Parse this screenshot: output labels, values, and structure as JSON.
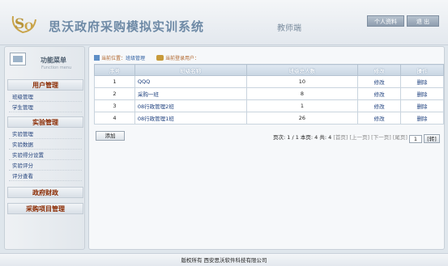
{
  "header": {
    "logo_text": "SO",
    "title": "思沃政府采购模拟实训系统",
    "role": "教师端",
    "buttons": [
      "个人资料",
      "退 出"
    ]
  },
  "sidebar": {
    "title": "功能菜单",
    "subtitle": "Function menu",
    "sections": [
      {
        "label": "用户管理",
        "items": [
          "班级管理",
          "学生管理"
        ]
      },
      {
        "label": "实验管理",
        "items": [
          "实验管理",
          "实验数据",
          "实验得分设置",
          "实验评分",
          "评分查看"
        ]
      },
      {
        "label": "政府财政",
        "items": []
      },
      {
        "label": "采购项目管理",
        "items": []
      }
    ]
  },
  "breadcrumb": {
    "prefix": "当前位置：",
    "current": "班级管理",
    "login_label": "当前登录用户："
  },
  "table": {
    "headers": [
      "序号",
      "班级名称",
      "班级总人数",
      "修改",
      "操作"
    ],
    "rows": [
      {
        "no": "1",
        "name": "QQQ",
        "count": "10",
        "edit": "修改",
        "del": "删除"
      },
      {
        "no": "2",
        "name": "采购一班",
        "count": "8",
        "edit": "修改",
        "del": "删除"
      },
      {
        "no": "3",
        "name": "08行政管理2班",
        "count": "1",
        "edit": "修改",
        "del": "删除"
      },
      {
        "no": "4",
        "name": "08行政管理1班",
        "count": "26",
        "edit": "修改",
        "del": "删除"
      }
    ]
  },
  "actions": {
    "add_label": "添加"
  },
  "pager": {
    "info": "页次: 1 / 1 本页: 4 共: 4",
    "first": "[首页]",
    "prev": "[上一页]",
    "next": "[下一页]",
    "last": "[尾页]",
    "page_value": "1",
    "go_label": "[转]"
  },
  "footer": {
    "text": "版权所有  西安思沃软件科技有限公司"
  },
  "colors": {
    "accent": "#6e8aa6",
    "section_text": "#8b2a00",
    "link": "#1f3f7a"
  }
}
